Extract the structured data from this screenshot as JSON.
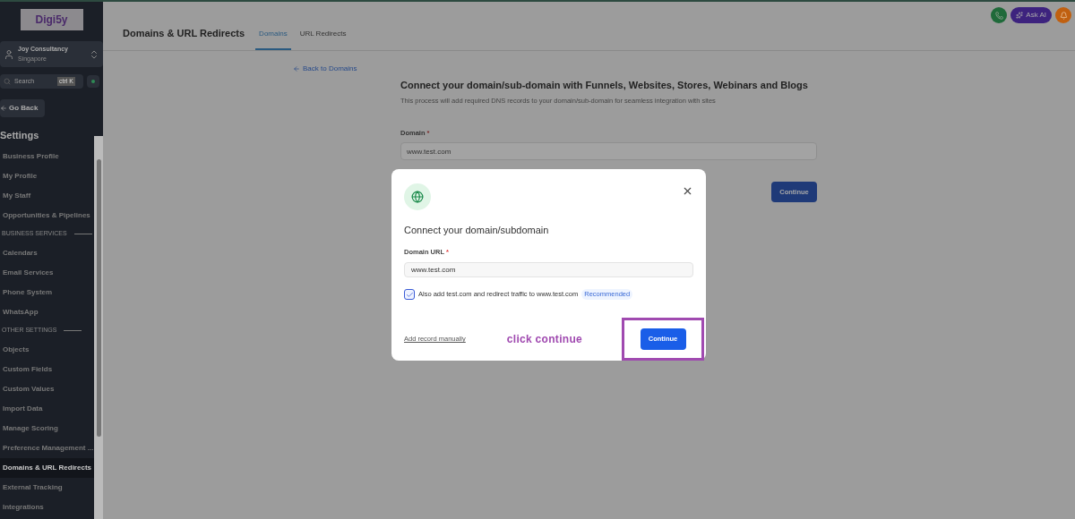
{
  "sidebar": {
    "logo": "Digi5y",
    "account": {
      "name": "Joy Consultancy",
      "location": "Singapore"
    },
    "search": {
      "placeholder": "Search",
      "shortcut": "ctrl K"
    },
    "go_back": "Go Back",
    "heading": "Settings",
    "items": [
      {
        "kind": "item",
        "label": "Business Profile",
        "selected": false
      },
      {
        "kind": "item",
        "label": "My Profile",
        "selected": false
      },
      {
        "kind": "item",
        "label": "My Staff",
        "selected": false
      },
      {
        "kind": "item",
        "label": "Opportunities & Pipelines",
        "selected": false
      },
      {
        "kind": "section",
        "label": "BUSINESS SERVICES"
      },
      {
        "kind": "item",
        "label": "Calendars",
        "selected": false
      },
      {
        "kind": "item",
        "label": "Email Services",
        "selected": false
      },
      {
        "kind": "item",
        "label": "Phone System",
        "selected": false
      },
      {
        "kind": "item",
        "label": "WhatsApp",
        "selected": false
      },
      {
        "kind": "section",
        "label": "OTHER SETTINGS"
      },
      {
        "kind": "item",
        "label": "Objects",
        "selected": false
      },
      {
        "kind": "item",
        "label": "Custom Fields",
        "selected": false
      },
      {
        "kind": "item",
        "label": "Custom Values",
        "selected": false
      },
      {
        "kind": "item",
        "label": "Import Data",
        "selected": false
      },
      {
        "kind": "item",
        "label": "Manage Scoring",
        "selected": false
      },
      {
        "kind": "item",
        "label": "Preference Management ...",
        "selected": false
      },
      {
        "kind": "item",
        "label": "Domains & URL Redirects",
        "selected": true
      },
      {
        "kind": "item",
        "label": "External Tracking",
        "selected": false
      },
      {
        "kind": "item",
        "label": "Integrations",
        "selected": false
      }
    ]
  },
  "topbar": {
    "ask_ai": "Ask AI"
  },
  "page": {
    "title": "Domains & URL Redirects",
    "tabs": [
      {
        "label": "Domains",
        "selected": true
      },
      {
        "label": "URL Redirects",
        "selected": false
      }
    ],
    "back_link": "Back to Domains",
    "heading": "Connect your domain/sub-domain with Funnels, Websites, Stores, Webinars and Blogs",
    "description": "This process will add required DNS records to your domain/sub-domain for seamless integration with sites",
    "domain_label": "Domain",
    "domain_required": "*",
    "domain_value": "www.test.com",
    "continue": "Continue"
  },
  "modal": {
    "title": "Connect your domain/subdomain",
    "field_label": "Domain URL",
    "field_required": "*",
    "field_value": "www.test.com",
    "checkbox": {
      "label": "Also add test.com and redirect traffic to www.test.com",
      "checked": true,
      "badge": "Recommended"
    },
    "manual_link": "Add record manually",
    "continue": "Continue"
  },
  "annotation": {
    "text": "click continue"
  }
}
